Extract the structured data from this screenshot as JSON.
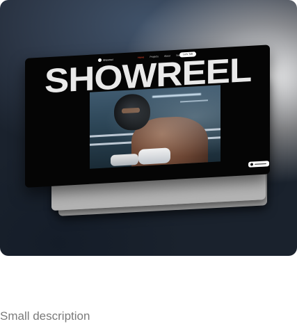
{
  "showcase": {
    "mockup": {
      "brand": {
        "name": "Showreel",
        "logo_icon": "circle-logo-icon"
      },
      "nav": {
        "items": [
          {
            "label": "Home",
            "active": true
          },
          {
            "label": "Projects",
            "active": false
          },
          {
            "label": "About",
            "active": false
          },
          {
            "label": "Services",
            "active": false
          },
          {
            "label": "Blog",
            "active": false
          }
        ],
        "cta_label": "Let's Talk"
      },
      "hero_title": "SHOWREEL",
      "video_alt_icon": "video-still-icon",
      "corner_badge_icon": "play-badge-icon"
    },
    "description": "Small description"
  },
  "colors": {
    "accent": "#ff4a2e",
    "screen_bg": "#050505",
    "title_text": "#e9e9e9",
    "description_text": "#7a7a7a"
  }
}
